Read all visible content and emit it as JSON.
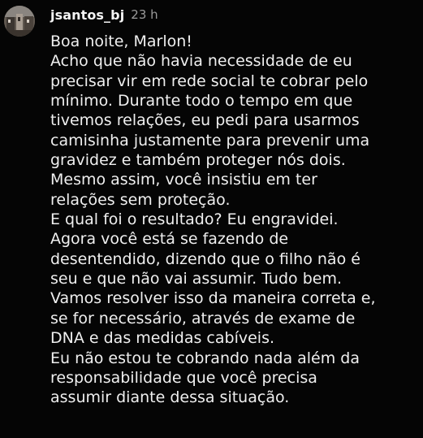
{
  "comment": {
    "username": "jsantos_bj",
    "timestamp": "23 h",
    "avatar_icon": "profile-avatar",
    "lines": [
      "Boa noite, Marlon!",
      "Acho que não havia necessidade de eu",
      "precisar vir em rede social te cobrar pelo",
      "mínimo. Durante todo o tempo em que",
      "tivemos relações, eu pedi para usarmos",
      "camisinha justamente para prevenir uma",
      "gravidez e também proteger nós dois.",
      "Mesmo assim, você insistiu em ter",
      "relações sem proteção.",
      "E qual foi o resultado? Eu engravidei.",
      "Agora você está se fazendo de",
      "desentendido, dizendo que o filho não é",
      "seu e que não vai assumir. Tudo bem.",
      "Vamos resolver isso da maneira correta e,",
      "se for necessário, através de exame de",
      "DNA e das medidas cabíveis.",
      "Eu não estou te cobrando nada além da",
      "responsabilidade que você precisa",
      "assumir diante dessa situação."
    ]
  },
  "colors": {
    "background": "#050505",
    "text": "#efefef",
    "timestamp": "#9a9a9a"
  }
}
